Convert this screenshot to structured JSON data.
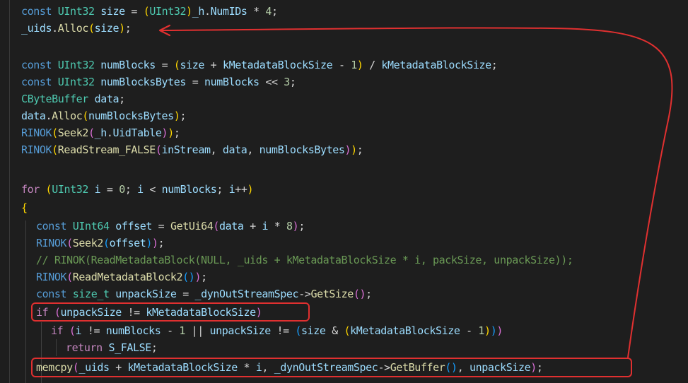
{
  "code": {
    "line1": [
      "const",
      "UInt32",
      "size",
      "=",
      "(",
      "UInt32",
      ")",
      "_h",
      ".",
      "NumIDs",
      "*",
      "4",
      ";"
    ],
    "line2": [
      "_uids",
      ".",
      "Alloc",
      "(",
      "size",
      ")",
      ";"
    ],
    "line3": [
      "const",
      "UInt32",
      "numBlocks",
      "=",
      "(",
      "size",
      "+",
      "kMetadataBlockSize",
      "-",
      "1",
      ")",
      "/",
      "kMetadataBlockSize",
      ";"
    ],
    "line4": [
      "const",
      "UInt32",
      "numBlocksBytes",
      "=",
      "numBlocks",
      "<<",
      "3",
      ";"
    ],
    "line5": [
      "CByteBuffer",
      "data",
      ";"
    ],
    "line6": [
      "data",
      ".",
      "Alloc",
      "(",
      "numBlocksBytes",
      ")",
      ";"
    ],
    "line7": [
      "RINOK",
      "(",
      "Seek2",
      "(",
      "_h",
      ".",
      "UidTable",
      ")",
      ")",
      ";"
    ],
    "line8": [
      "RINOK",
      "(",
      "ReadStream_FALSE",
      "(",
      "inStream",
      ",",
      "data",
      ",",
      "numBlocksBytes",
      ")",
      ")",
      ";"
    ],
    "line9": [
      "for",
      "(",
      "UInt32",
      "i",
      "=",
      "0",
      ";",
      "i",
      "<",
      "numBlocks",
      ";",
      "i",
      "++",
      ")"
    ],
    "line10": [
      "{"
    ],
    "line11": [
      "const",
      "UInt64",
      "offset",
      "=",
      "GetUi64",
      "(",
      "data",
      "+",
      "i",
      "*",
      "8",
      ")",
      ";"
    ],
    "line12": [
      "RINOK",
      "(",
      "Seek2",
      "(",
      "offset",
      ")",
      ")",
      ";"
    ],
    "line13": [
      "// RINOK(ReadMetadataBlock(NULL, _uids + kMetadataBlockSize * i, packSize, unpackSize));"
    ],
    "line14": [
      "RINOK",
      "(",
      "ReadMetadataBlock2",
      "(",
      ")",
      ")",
      ";"
    ],
    "line15": [
      "const",
      "size_t",
      "unpackSize",
      "=",
      "_dynOutStreamSpec",
      "->",
      "GetSize",
      "(",
      ")",
      ";"
    ],
    "line16": [
      "if",
      "(",
      "unpackSize",
      "!=",
      "kMetadataBlockSize",
      ")"
    ],
    "line17": [
      "if",
      "(",
      "i",
      "!=",
      "numBlocks",
      "-",
      "1",
      "||",
      "unpackSize",
      "!=",
      "(",
      "size",
      "&",
      "(",
      "kMetadataBlockSize",
      "-",
      "1",
      ")",
      ")",
      ")"
    ],
    "line18": [
      "return",
      "S_FALSE",
      ";"
    ],
    "line19": [
      "memcpy",
      "(",
      "_uids",
      "+",
      "kMetadataBlockSize",
      "*",
      "i",
      ",",
      "_dynOutStreamSpec",
      "->",
      "GetBuffer",
      "(",
      ")",
      ",",
      "unpackSize",
      ")",
      ";"
    ]
  },
  "annotations": {
    "box_color": "#e03030",
    "arrow_color": "#e03030"
  }
}
